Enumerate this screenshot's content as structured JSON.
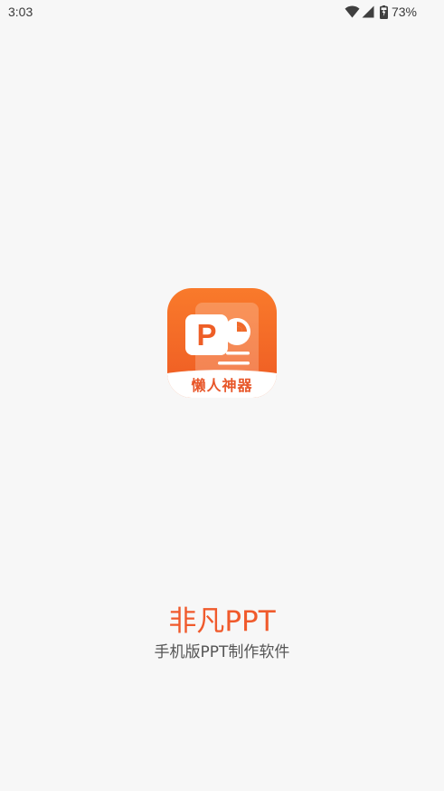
{
  "status_bar": {
    "time": "3:03",
    "battery_percent": "73%",
    "icons": [
      "wifi-icon",
      "cell-signal-icon",
      "battery-charging-icon"
    ]
  },
  "app_icon": {
    "icon_letter": "P",
    "label": "懒人神器",
    "colors": {
      "gradient_top": "#f97a2b",
      "gradient_bottom": "#ee5a23",
      "label": "#e8572a"
    }
  },
  "app_title": "非凡PPT",
  "app_subtitle": "手机版PPT制作软件",
  "colors": {
    "background": "#f7f7f7",
    "title": "#f05a2c",
    "subtitle": "#555555"
  }
}
